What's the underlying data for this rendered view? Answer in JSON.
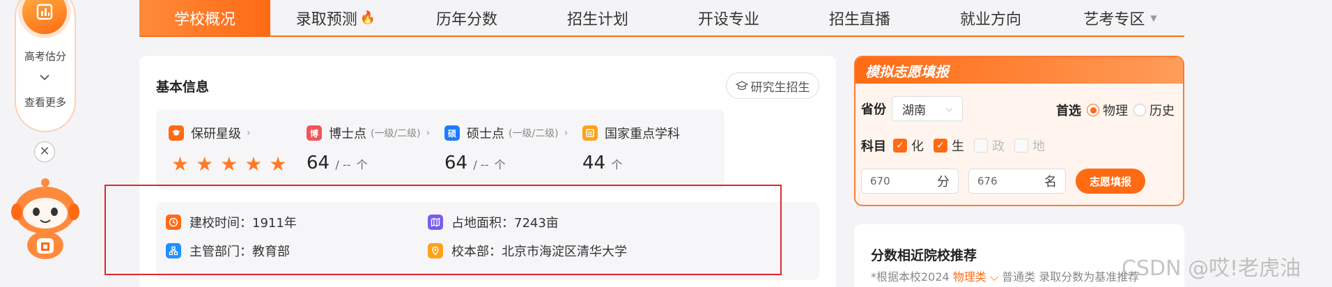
{
  "widget": {
    "label": "高考估分",
    "more": "查看更多",
    "close": "✕"
  },
  "nav": {
    "items": [
      {
        "label": "学校概况",
        "active": true
      },
      {
        "label": "录取预测",
        "hot": true
      },
      {
        "label": "历年分数"
      },
      {
        "label": "招生计划"
      },
      {
        "label": "开设专业"
      },
      {
        "label": "招生直播"
      },
      {
        "label": "就业方向"
      },
      {
        "label": "艺考专区",
        "dropdown": true
      }
    ],
    "dropdown_glyph": "▼",
    "hot_glyph": "🔥"
  },
  "basic": {
    "title": "基本信息",
    "grad_button": "研究生招生",
    "stats": [
      {
        "label": "保研星级",
        "rating_of_5": 5,
        "badge_color": "#ff6a13"
      },
      {
        "label": "博士点",
        "sub": "(一级/二级)",
        "badge_text": "博",
        "badge_color": "#f2545b",
        "value": "64",
        "suffix": "/ --",
        "unit": "个"
      },
      {
        "label": "硕士点",
        "sub": "(一级/二级)",
        "badge_text": "硕",
        "badge_color": "#1e7bff",
        "value": "64",
        "suffix": "/ --",
        "unit": "个"
      },
      {
        "label": "国家重点学科",
        "badge_color": "#ffa21a",
        "value": "44",
        "unit": "个"
      }
    ],
    "details": {
      "founded": "建校时间：1911年",
      "area": "占地面积：7243亩",
      "department": "主管部门：教育部",
      "campus": "校本部：北京市海淀区清华大学"
    }
  },
  "sim": {
    "title": "模拟志愿填报",
    "province_label": "省份",
    "province_value": "湖南",
    "first_choice_label": "首选",
    "first_choice_options": [
      {
        "label": "物理",
        "checked": true
      },
      {
        "label": "历史",
        "checked": false
      }
    ],
    "subject_label": "科目",
    "subjects": [
      {
        "label": "化",
        "checked": true
      },
      {
        "label": "生",
        "checked": true
      },
      {
        "label": "政",
        "checked": false
      },
      {
        "label": "地",
        "checked": false
      }
    ],
    "score_placeholder": "670",
    "score_unit": "分",
    "rank_placeholder": "676",
    "rank_unit": "名",
    "submit": "志愿填报"
  },
  "recommend": {
    "title": "分数相近院校推荐",
    "sub_prefix": "*根据本校2024",
    "sub_accent": "物理类",
    "sub_suffix": "普通类 录取分数为基准推荐"
  },
  "watermark": "CSDN @哎!老虎油",
  "colors": {
    "accent": "#ff6a13",
    "highlight": "#e0272b"
  }
}
